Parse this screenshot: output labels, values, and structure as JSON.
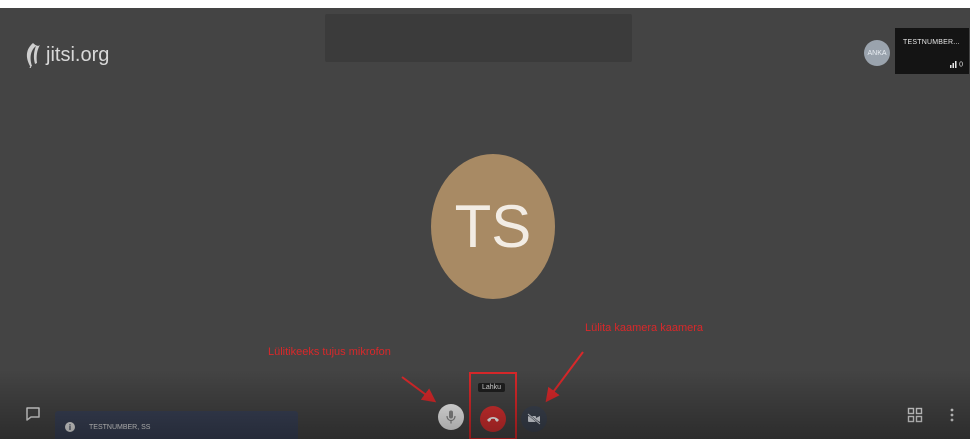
{
  "brand": {
    "logo_text": "jitsi.org",
    "logo_icon": "leaf-icon"
  },
  "remote_thumbnail": {
    "avatar_initials": "ANKA",
    "name": "TESTNUMBER...",
    "status_text": "0",
    "status_icon": "signal-icon"
  },
  "main_avatar": {
    "initials": "TS",
    "color": "#a88a64"
  },
  "annotations": {
    "left_label": "Lülitikeeks tujus mikrofon",
    "right_label": "Lülita kaamera kaamera",
    "color": "#d9282a"
  },
  "toolbar": {
    "hangup_tooltip": "Lahku",
    "mic_icon": "microphone-icon",
    "hangup_icon": "phone-hangup-icon",
    "camera_icon": "camera-off-icon",
    "chat_icon": "chat-icon",
    "tile_view_icon": "tile-view-icon",
    "more_icon": "more-vertical-icon"
  },
  "participant_bar": {
    "info_icon_text": "i",
    "name": "TESTNUMBER, SS"
  },
  "colors": {
    "stage_background": "#444444",
    "hangup_red": "#d63030",
    "participant_bar": "#3a4257"
  }
}
